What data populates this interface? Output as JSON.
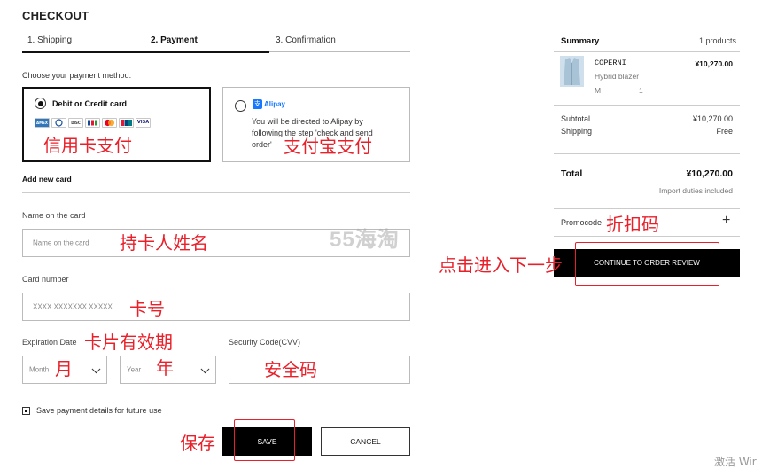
{
  "header": {
    "title": "CHECKOUT"
  },
  "steps": [
    {
      "label": "1. Shipping"
    },
    {
      "label": "2. Payment"
    },
    {
      "label": "3. Confirmation"
    }
  ],
  "payment": {
    "choose_label": "Choose your payment method:",
    "card_option": {
      "label": "Debit or Credit card",
      "selected": true,
      "brands": [
        "amex",
        "diners",
        "discover",
        "jcb",
        "mastercard",
        "unionpay",
        "visa"
      ]
    },
    "alipay_option": {
      "logo_text": "Alipay",
      "description": "You will be directed to Alipay by following the step 'check and send order'",
      "selected": false
    }
  },
  "card_form": {
    "section_title": "Add new card",
    "name_label": "Name on the card",
    "name_placeholder": "Name on the card",
    "number_label": "Card number",
    "number_placeholder": "XXXX XXXXXXX XXXXX",
    "expiration_label": "Expiration Date",
    "month_value": "Month",
    "year_value": "Year",
    "cvv_label": "Security Code(CVV)",
    "save_details_label": "Save payment details for future use",
    "save_details_checked": true
  },
  "buttons": {
    "save": "SAVE",
    "cancel": "CANCEL",
    "continue": "CONTINUE TO ORDER REVIEW"
  },
  "summary": {
    "title": "Summary",
    "count": "1 products",
    "item": {
      "brand": "COPERNI",
      "name": "Hybrid blazer",
      "size": "M",
      "qty": "1",
      "price": "¥10,270.00"
    },
    "subtotal_label": "Subtotal",
    "subtotal_value": "¥10,270.00",
    "shipping_label": "Shipping",
    "shipping_value": "Free",
    "total_label": "Total",
    "total_value": "¥10,270.00",
    "duties_note": "Import duties included",
    "promocode_label": "Promocode"
  },
  "annotations": {
    "card_pay": "信用卡支付",
    "alipay_pay": "支付宝支付",
    "holder_name": "持卡人姓名",
    "card_number": "卡号",
    "expiry": "卡片有效期",
    "month": "月",
    "year": "年",
    "cvv": "安全码",
    "save": "保存",
    "promo": "折扣码",
    "next_step": "点击进入下一步"
  },
  "watermark": {
    "text": "55海淘",
    "corner": "激活 Wir"
  },
  "colors": {
    "annotation_red": "#e8202a",
    "alipay_blue": "#1677ff",
    "button_black": "#000000"
  }
}
